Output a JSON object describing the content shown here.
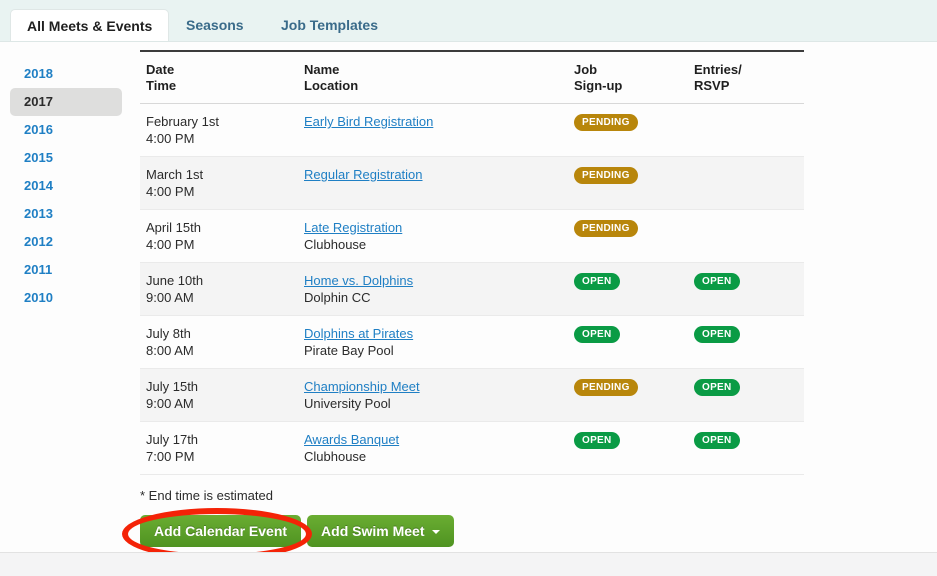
{
  "tabs": [
    {
      "label": "All Meets & Events",
      "active": true
    },
    {
      "label": "Seasons",
      "active": false
    },
    {
      "label": "Job Templates",
      "active": false
    }
  ],
  "years": {
    "items": [
      {
        "label": "2018",
        "selected": false
      },
      {
        "label": "2017",
        "selected": true
      },
      {
        "label": "2016",
        "selected": false
      },
      {
        "label": "2015",
        "selected": false
      },
      {
        "label": "2014",
        "selected": false
      },
      {
        "label": "2013",
        "selected": false
      },
      {
        "label": "2012",
        "selected": false
      },
      {
        "label": "2011",
        "selected": false
      },
      {
        "label": "2010",
        "selected": false
      }
    ]
  },
  "table": {
    "headers": {
      "date_line1": "Date",
      "date_line2": "Time",
      "name_line1": "Name",
      "name_line2": "Location",
      "job_line1": "Job",
      "job_line2": "Sign-up",
      "rsvp_line1": "Entries/",
      "rsvp_line2": "RSVP"
    },
    "rows": [
      {
        "date": "February 1st",
        "time": "4:00 PM",
        "name": "Early Bird Registration",
        "location": "",
        "job_signup": "PENDING",
        "job_signup_state": "pending",
        "entries_rsvp": "",
        "entries_rsvp_state": ""
      },
      {
        "date": "March 1st",
        "time": "4:00 PM",
        "name": "Regular Registration",
        "location": "",
        "job_signup": "PENDING",
        "job_signup_state": "pending",
        "entries_rsvp": "",
        "entries_rsvp_state": ""
      },
      {
        "date": "April 15th",
        "time": "4:00 PM",
        "name": "Late Registration",
        "location": "Clubhouse",
        "job_signup": "PENDING",
        "job_signup_state": "pending",
        "entries_rsvp": "",
        "entries_rsvp_state": ""
      },
      {
        "date": "June 10th",
        "time": "9:00 AM",
        "name": "Home vs. Dolphins",
        "location": "Dolphin CC",
        "job_signup": "OPEN",
        "job_signup_state": "open",
        "entries_rsvp": "OPEN",
        "entries_rsvp_state": "open"
      },
      {
        "date": "July 8th",
        "time": "8:00 AM",
        "name": "Dolphins at Pirates",
        "location": "Pirate Bay Pool",
        "job_signup": "OPEN",
        "job_signup_state": "open",
        "entries_rsvp": "OPEN",
        "entries_rsvp_state": "open"
      },
      {
        "date": "July 15th",
        "time": "9:00 AM",
        "name": "Championship Meet",
        "location": "University Pool",
        "job_signup": "PENDING",
        "job_signup_state": "pending",
        "entries_rsvp": "OPEN",
        "entries_rsvp_state": "open"
      },
      {
        "date": "July 17th",
        "time": "7:00 PM",
        "name": "Awards Banquet",
        "location": "Clubhouse",
        "job_signup": "OPEN",
        "job_signup_state": "open",
        "entries_rsvp": "OPEN",
        "entries_rsvp_state": "open"
      }
    ]
  },
  "footnote": "* End time is estimated",
  "buttons": {
    "add_calendar_event": "Add Calendar Event",
    "add_swim_meet": "Add Swim Meet"
  },
  "colors": {
    "tabbar_background": "#e9f3f2",
    "link": "#1f7fc4",
    "badge_pending": "#b8860b",
    "badge_open": "#0a9b45",
    "button_green": "#5a9e28",
    "annotation_red": "#f42307",
    "row_alt": "#f4f4f4",
    "year_selected": "#dededd"
  }
}
